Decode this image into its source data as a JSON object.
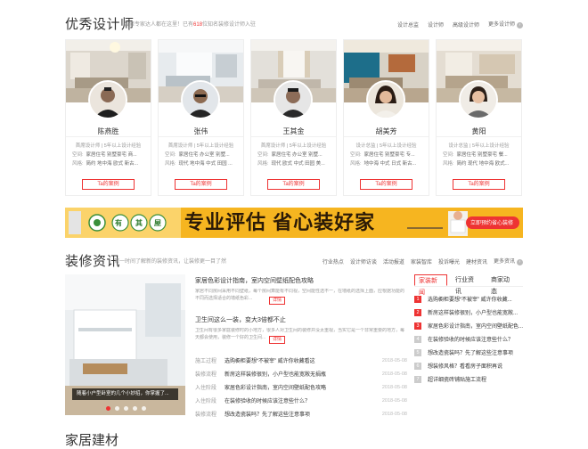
{
  "designers_section": {
    "title": "优秀设计师",
    "subtitle_pre": "装修专家达人都在这里！已有",
    "subtitle_count": "618",
    "subtitle_post": "位知名装修设计师入驻",
    "nav": [
      "设计总监",
      "设计师",
      "高级设计师",
      "更多设计师"
    ],
    "designers": [
      {
        "name": "陈燕胜",
        "level": "首席设计师 | 5年以上设计经验",
        "space_label": "空间:",
        "space": "家居住宅 别墅豪宅 商...",
        "style_label": "风格:",
        "style": "简约 地中海 欧式 新古...",
        "button": "Ta的案例"
      },
      {
        "name": "张伟",
        "level": "首席设计师 | 5年以上设计经验",
        "space_label": "空间:",
        "space": "家居住宅 办公室 别墅...",
        "style_label": "风格:",
        "style": "现代 地中海 中式 田园 ...",
        "button": "Ta的案例"
      },
      {
        "name": "王其金",
        "level": "首席设计师 | 5年以上设计经验",
        "space_label": "空间:",
        "space": "家居住宅 办公室 别墅...",
        "style_label": "风格:",
        "style": "现代 欧式 中式 田园 美...",
        "button": "Ta的案例"
      },
      {
        "name": "胡美芳",
        "level": "设计总监 | 5年以上设计经验",
        "space_label": "空间:",
        "space": "家居住宅 别墅豪宅 专...",
        "style_label": "风格:",
        "style": "地中海 中式 日式 新古...",
        "button": "Ta的案例"
      },
      {
        "name": "黄阳",
        "level": "设计总监 | 5年以上设计经验",
        "space_label": "空间:",
        "space": "家居住宅 别墅豪宅 餐...",
        "style_label": "风格:",
        "style": "简约 现代 地中海 欧式...",
        "button": "Ta的案例"
      }
    ]
  },
  "banner": {
    "brand_chars": [
      "有",
      "其",
      "屋"
    ],
    "slogan": "专业评估 省心装好家",
    "cta": "立即预约省心装修"
  },
  "news_section": {
    "title": "装修资讯",
    "subtitle": "第一时间了解新的装修资讯，让装修更一目了然",
    "nav": [
      "行业热点",
      "设计师访谈",
      "活动报道",
      "家装智库",
      "投诉曝光",
      "建材资讯",
      "更多资讯"
    ],
    "slide_caption": "随着小户型卧室的几个小妙招，你掌握了...",
    "featured": [
      {
        "title": "家居色彩设计指南，室内空间壁纸配色攻略",
        "summary": "家居不同房间采用不同壁纸，每个房间算能有不同视，空间能性选不一，在墙纸的选择上面，应根据功能的不同而选择适合的墙纸色彩...",
        "detail": "详情"
      },
      {
        "title": "卫生间这么一装，变大3倍都不止",
        "summary": "卫生间有很多家庭装修时的小地方，很多人对卫生间的装修并没太重视，当实它是一个非常重要的地方，每天都会使用，装修一个好的卫生间...",
        "detail": "详情"
      }
    ],
    "list": [
      {
        "cat": "施工过程",
        "title": "选购橱柜要想“不被宰”  威许你收藏看这",
        "date": "2018-05-08"
      },
      {
        "cat": "装修流程",
        "title": "新房这样装修很别，小户型也能宽敞无捐瓶",
        "date": "2018-05-08"
      },
      {
        "cat": "入住阶段",
        "title": "家居色彩设计指南，室内空间壁纸配色攻略",
        "date": "2018-05-08"
      },
      {
        "cat": "入住阶段",
        "title": "在装修验收的时候应该注意些什么？",
        "date": "2018-05-08"
      },
      {
        "cat": "装修流程",
        "title": "想改造瓷装吗？先了解这些注意事项",
        "date": "2018-05-08"
      }
    ],
    "tabs": [
      "家装新闻",
      "行业资讯",
      "商家动态"
    ],
    "ranked": [
      {
        "num": "1",
        "title": "选购橱柜要想“不被宰”  威许你收藏..."
      },
      {
        "num": "2",
        "title": "新房这样装修很别，小户型也能宽敞..."
      },
      {
        "num": "3",
        "title": "家居色彩设计指南，室内空间壁纸配色..."
      },
      {
        "num": "4",
        "title": "在装修验收的时候应该注意些什么？"
      },
      {
        "num": "5",
        "title": "想改造瓷装吗？先了解这些注意事项"
      },
      {
        "num": "6",
        "title": "想装修风格？看看房子面积再说"
      },
      {
        "num": "7",
        "title": "超详细瓷砖铺贴施工流程"
      }
    ]
  },
  "next_section_title": "家居建材",
  "colors": {
    "accent": "#ee3333",
    "banner_yellow": "#f6b520",
    "banner_green": "#3a8f3a"
  }
}
